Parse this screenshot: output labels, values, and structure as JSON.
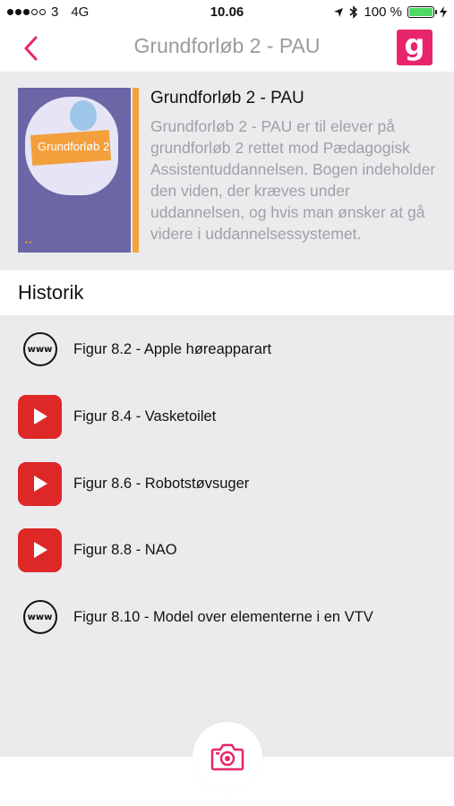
{
  "status_bar": {
    "carrier": "3",
    "network": "4G",
    "time": "10.06",
    "battery": "100 %",
    "battery_level": 1.0
  },
  "nav": {
    "title": "Grundforløb 2 - PAU",
    "back_icon": "chevron-left-icon",
    "logo_letter": "g"
  },
  "book": {
    "cover_title": "Grundforløb 2",
    "title": "Grundforløb 2 - PAU",
    "description": "Grundforløb 2 - PAU er til elever på grundforløb 2 rettet mod Pædagogisk Assistentuddannelsen. Bogen indeholder den viden, der kræves under uddannelsen, og hvis man ønsker at gå videre i uddannelsessystemet."
  },
  "history": {
    "heading": "Historik",
    "items": [
      {
        "type": "www",
        "icon": "www-icon",
        "label": "Figur 8.2 - Apple høreapparart"
      },
      {
        "type": "video",
        "icon": "youtube-play-icon",
        "label": "Figur 8.4 - Vasketoilet"
      },
      {
        "type": "video",
        "icon": "youtube-play-icon",
        "label": "Figur 8.6 - Robotstøvsuger"
      },
      {
        "type": "video",
        "icon": "youtube-play-icon",
        "label": "Figur 8.8 - NAO"
      },
      {
        "type": "www",
        "icon": "www-icon",
        "label": "Figur 8.10 - Model over elementerne i en VTV"
      }
    ]
  },
  "icons": {
    "www_text": "www"
  },
  "colors": {
    "accent": "#e8256b",
    "youtube_red": "#dd2827",
    "book_stripe": "#f6a33b",
    "panel_bg": "#ebebee"
  }
}
